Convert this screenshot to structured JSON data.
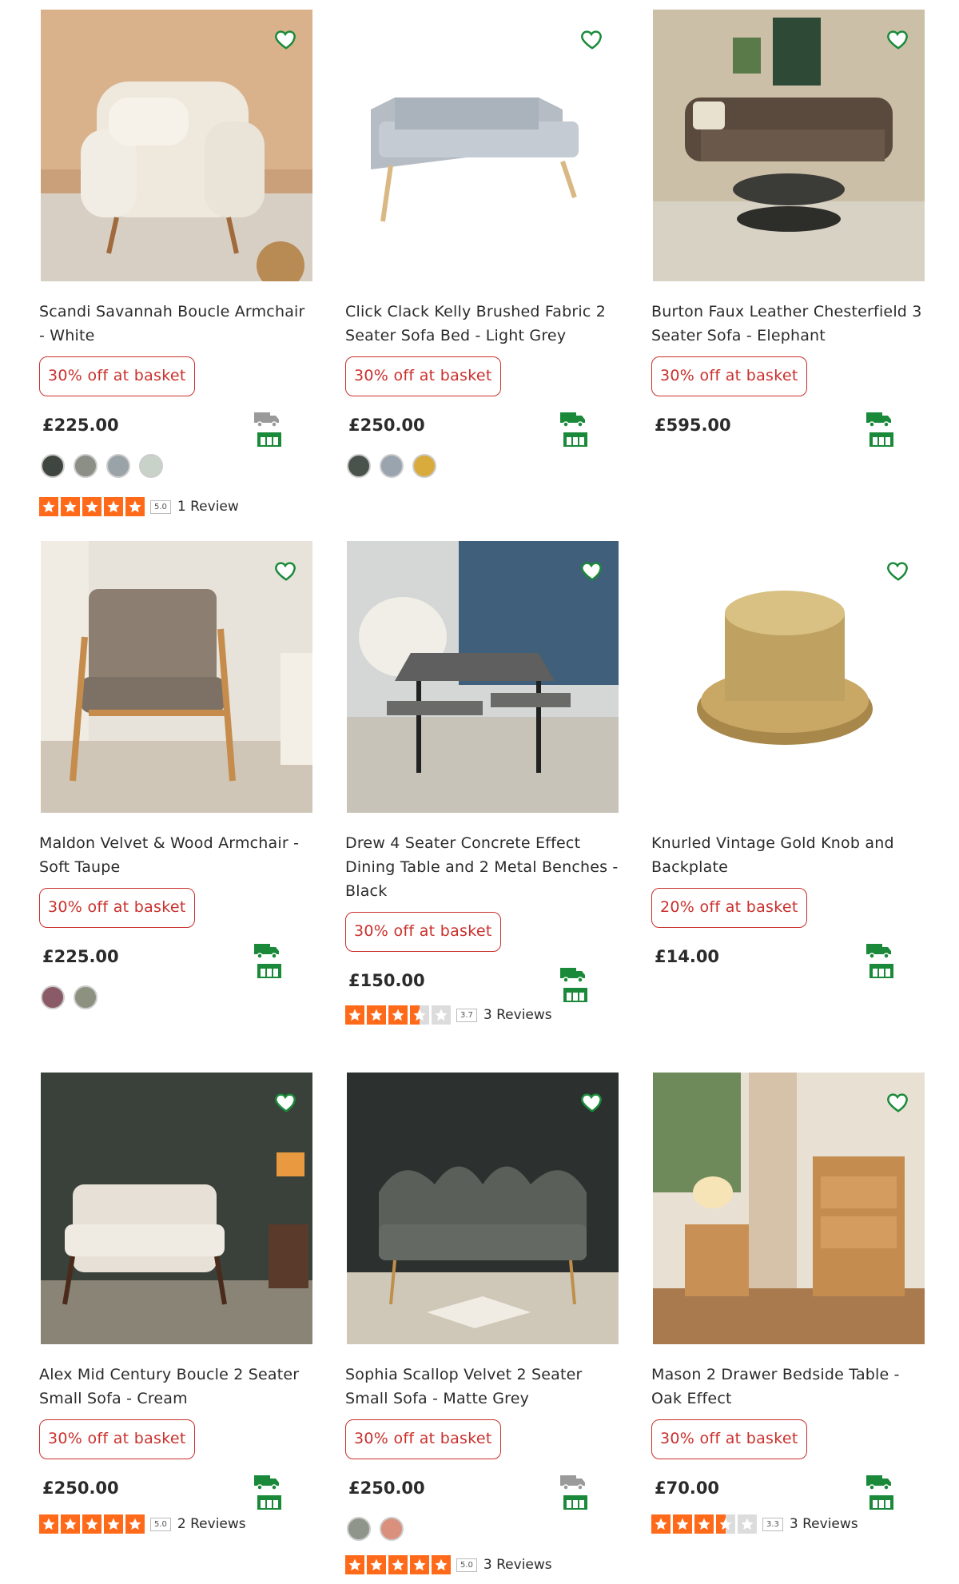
{
  "colors": {
    "accent": "#c9302c",
    "delivery": "#1a8a3a",
    "star": "#ff6a1a"
  },
  "products": [
    {
      "title": "Scandi Savannah Boucle Armchair - White",
      "offer": "30% off at basket",
      "price": "£225.00",
      "home_delivery_enabled": false,
      "swatches": [
        "#3f4640",
        "#8c8f85",
        "#9aa3a8",
        "#c9d2c9"
      ],
      "rating": {
        "stars": 5,
        "score": "5.0",
        "reviews": "1 Review"
      }
    },
    {
      "title": "Click Clack Kelly Brushed Fabric 2 Seater Sofa Bed - Light Grey",
      "offer": "30% off at basket",
      "price": "£250.00",
      "home_delivery_enabled": true,
      "swatches": [
        "#4a524c",
        "#9aa4ae",
        "#d9aa3c"
      ],
      "rating": null
    },
    {
      "title": "Burton Faux Leather Chesterfield 3 Seater Sofa - Elephant",
      "offer": "30% off at basket",
      "price": "£595.00",
      "home_delivery_enabled": true,
      "swatches": [],
      "rating": null
    },
    {
      "title": "Maldon Velvet & Wood Armchair - Soft Taupe",
      "offer": "30% off at basket",
      "price": "£225.00",
      "home_delivery_enabled": true,
      "swatches": [
        "#8a5a66",
        "#8c9180"
      ],
      "rating": null
    },
    {
      "title": "Drew 4 Seater Concrete Effect Dining Table and 2 Metal Benches - Black",
      "offer": "30% off at basket",
      "price": "£150.00",
      "home_delivery_enabled": true,
      "swatches": [],
      "rating": {
        "stars": 3.5,
        "score": "3.7",
        "reviews": "3 Reviews"
      }
    },
    {
      "title": "Knurled Vintage Gold Knob and Backplate",
      "offer": "20% off at basket",
      "price": "£14.00",
      "home_delivery_enabled": true,
      "swatches": [],
      "rating": null
    },
    {
      "title": "Alex Mid Century Boucle 2 Seater Small Sofa - Cream",
      "offer": "30% off at basket",
      "price": "£250.00",
      "home_delivery_enabled": true,
      "swatches": [],
      "rating": {
        "stars": 5,
        "score": "5.0",
        "reviews": "2 Reviews"
      }
    },
    {
      "title": "Sophia Scallop Velvet 2 Seater Small Sofa - Matte Grey",
      "offer": "30% off at basket",
      "price": "£250.00",
      "home_delivery_enabled": false,
      "swatches": [
        "#8f958a",
        "#d9907c"
      ],
      "rating": {
        "stars": 5,
        "score": "5.0",
        "reviews": "3 Reviews"
      }
    },
    {
      "title": "Mason 2 Drawer Bedside Table - Oak Effect",
      "offer": "30% off at basket",
      "price": "£70.00",
      "home_delivery_enabled": true,
      "swatches": [],
      "rating": {
        "stars": 3.5,
        "score": "3.3",
        "reviews": "3 Reviews"
      }
    }
  ]
}
